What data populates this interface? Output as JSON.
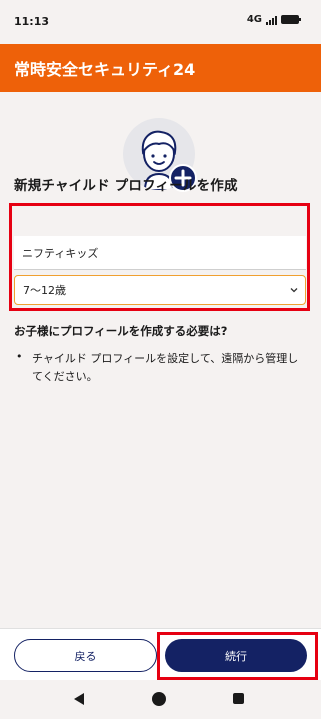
{
  "status_bar": {
    "time": "11:13",
    "network": "4G"
  },
  "header": {
    "title": "常時安全セキュリティ24"
  },
  "form": {
    "heading": "新規チャイルド プロフィールを作成",
    "name_value": "ニフティキッズ",
    "age_value": "7〜12歳"
  },
  "why": {
    "title": "お子様にプロフィールを作成する必要は?",
    "bullet": "•",
    "text": "チャイルド プロフィールを設定して、遠隔から管理してください。"
  },
  "footer": {
    "back_label": "戻る",
    "continue_label": "続行"
  },
  "colors": {
    "header_bg": "#ee6109",
    "primary": "#142264",
    "highlight": "#e60012"
  }
}
